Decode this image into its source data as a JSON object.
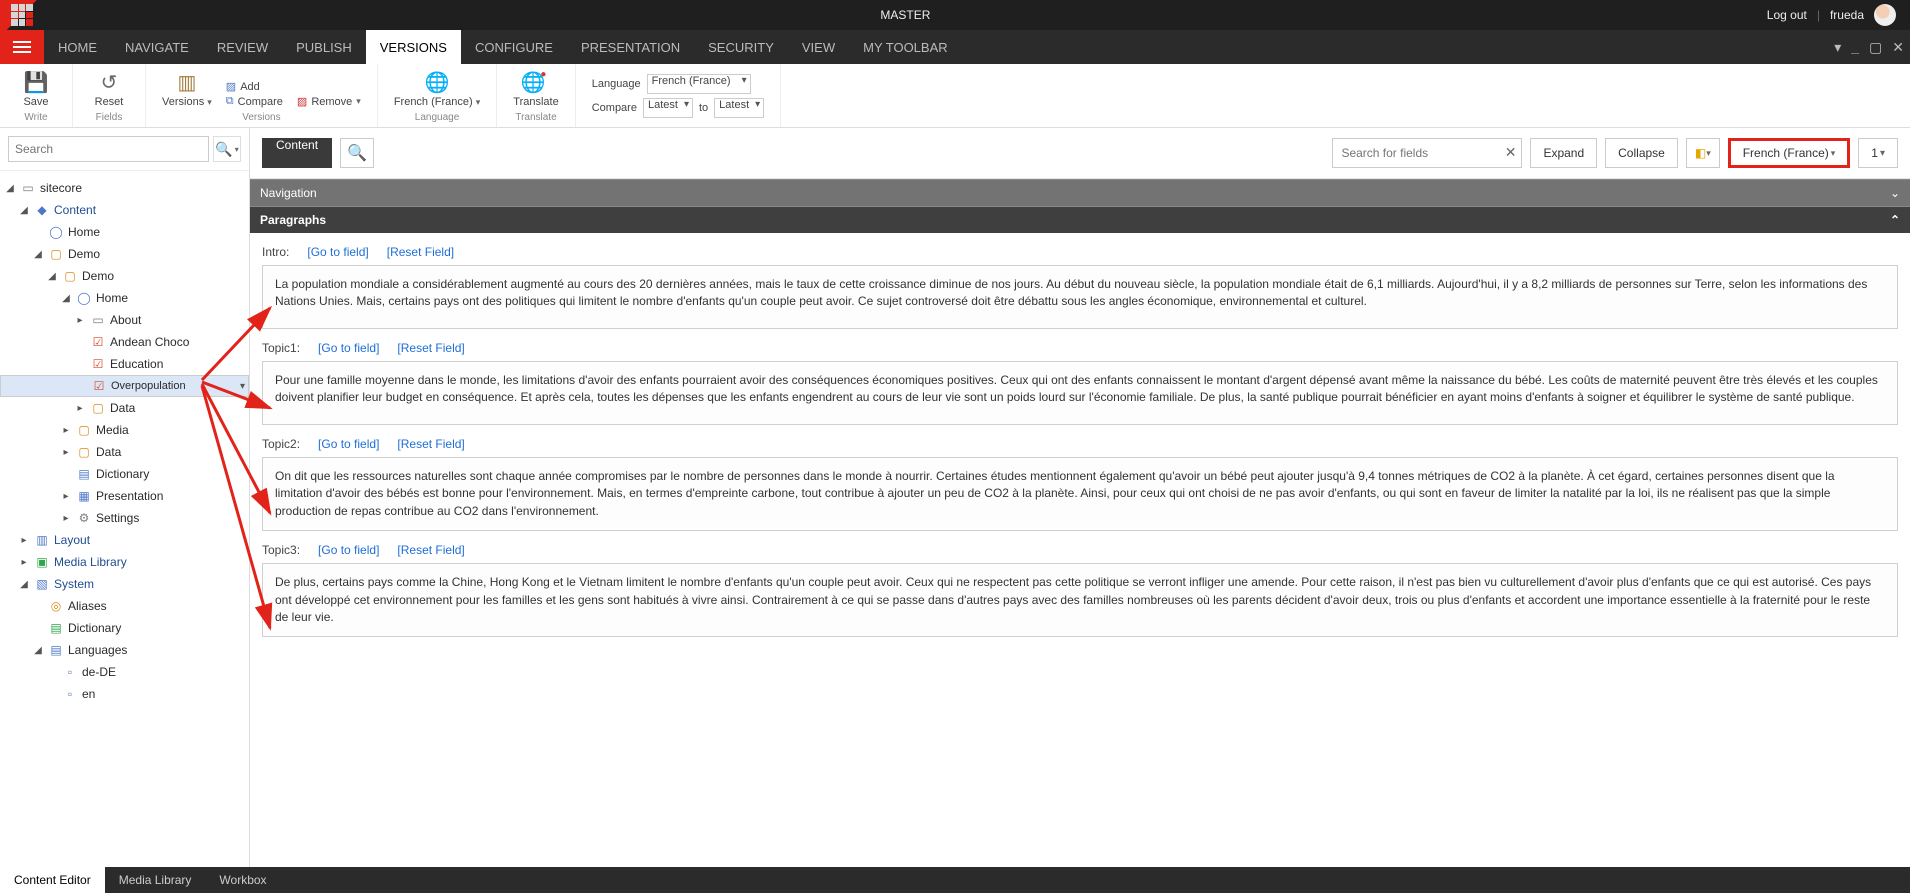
{
  "top": {
    "title": "MASTER",
    "logout": "Log out",
    "user": "frueda"
  },
  "menu": {
    "items": [
      "HOME",
      "NAVIGATE",
      "REVIEW",
      "PUBLISH",
      "VERSIONS",
      "CONFIGURE",
      "PRESENTATION",
      "SECURITY",
      "VIEW",
      "MY TOOLBAR"
    ],
    "active": "VERSIONS"
  },
  "ribbon": {
    "save": {
      "label": "Save",
      "sub": "Write"
    },
    "reset": {
      "label": "Reset",
      "sub": "Fields"
    },
    "versionsBtn": "Versions",
    "add": "Add",
    "compare": "Compare",
    "remove": "Remove",
    "versionsGroup": "Versions",
    "langBtn": "French (France)",
    "langGroup": "Language",
    "translate": "Translate",
    "translateGroup": "Translate",
    "langLabel": "Language",
    "langSel": "French (France)",
    "compareLabel": "Compare",
    "compareFrom": "Latest",
    "compareTo": "Latest",
    "to": "to"
  },
  "search": {
    "placeholder": "Search"
  },
  "tree": [
    {
      "d": 0,
      "open": true,
      "ic": "doc",
      "col": "gray",
      "lbl": "sitecore",
      "link": false
    },
    {
      "d": 1,
      "open": true,
      "ic": "cube",
      "col": "blue",
      "lbl": "Content",
      "link": true
    },
    {
      "d": 2,
      "open": false,
      "ic": "globe",
      "col": "blue",
      "lbl": "Home",
      "link": false,
      "leaf": true
    },
    {
      "d": 2,
      "open": true,
      "ic": "folder",
      "col": "orange",
      "lbl": "Demo",
      "link": false
    },
    {
      "d": 3,
      "open": true,
      "ic": "folder",
      "col": "orange",
      "lbl": "Demo",
      "link": false
    },
    {
      "d": 4,
      "open": true,
      "ic": "globe",
      "col": "blue",
      "lbl": "Home",
      "link": false
    },
    {
      "d": 5,
      "open": false,
      "ic": "doc",
      "col": "gray",
      "lbl": "About",
      "link": false
    },
    {
      "d": 5,
      "open": false,
      "ic": "chk",
      "col": "red",
      "lbl": "Andean Choco",
      "link": false,
      "leaf": true
    },
    {
      "d": 5,
      "open": false,
      "ic": "chk",
      "col": "red",
      "lbl": "Education",
      "link": false,
      "leaf": true
    },
    {
      "d": 5,
      "open": false,
      "ic": "chk",
      "col": "red",
      "lbl": "Overpopulation",
      "link": false,
      "leaf": true,
      "sel": true
    },
    {
      "d": 5,
      "open": false,
      "ic": "folder",
      "col": "orange",
      "lbl": "Data",
      "link": false
    },
    {
      "d": 4,
      "open": false,
      "ic": "folder",
      "col": "orange",
      "lbl": "Media",
      "link": false
    },
    {
      "d": 4,
      "open": false,
      "ic": "folder",
      "col": "orange",
      "lbl": "Data",
      "link": false
    },
    {
      "d": 4,
      "open": false,
      "ic": "book",
      "col": "blue",
      "lbl": "Dictionary",
      "link": false,
      "leaf": true
    },
    {
      "d": 4,
      "open": false,
      "ic": "slide",
      "col": "blue",
      "lbl": "Presentation",
      "link": false
    },
    {
      "d": 4,
      "open": false,
      "ic": "gear",
      "col": "gray",
      "lbl": "Settings",
      "link": false
    },
    {
      "d": 1,
      "open": false,
      "ic": "layout",
      "col": "blue",
      "lbl": "Layout",
      "link": true
    },
    {
      "d": 1,
      "open": false,
      "ic": "media",
      "col": "green",
      "lbl": "Media Library",
      "link": true
    },
    {
      "d": 1,
      "open": true,
      "ic": "sys",
      "col": "blue",
      "lbl": "System",
      "link": true
    },
    {
      "d": 2,
      "open": false,
      "ic": "alias",
      "col": "orange",
      "lbl": "Aliases",
      "link": false,
      "leaf": true
    },
    {
      "d": 2,
      "open": false,
      "ic": "book",
      "col": "green",
      "lbl": "Dictionary",
      "link": false,
      "leaf": true
    },
    {
      "d": 2,
      "open": true,
      "ic": "langs",
      "col": "blue",
      "lbl": "Languages",
      "link": false
    },
    {
      "d": 3,
      "open": false,
      "ic": "lang",
      "col": "blue",
      "lbl": "de-DE",
      "link": false,
      "leaf": true
    },
    {
      "d": 3,
      "open": false,
      "ic": "lang",
      "col": "blue",
      "lbl": "en",
      "link": false,
      "leaf": true
    }
  ],
  "toolbar": {
    "contentTab": "Content",
    "fieldSearch": "Search for fields",
    "expand": "Expand",
    "collapse": "Collapse",
    "language": "French (France)",
    "version": "1"
  },
  "sections": {
    "nav": "Navigation",
    "para": "Paragraphs",
    "goto": "[Go to field]",
    "reset": "[Reset Field]",
    "fields": [
      {
        "name": "Intro:",
        "text": "La population mondiale a considérablement augmenté au cours des 20 dernières années, mais le taux de cette croissance diminue de nos jours. Au début du nouveau siècle, la population mondiale était de 6,1 milliards. Aujourd'hui, il y a 8,2 milliards de personnes sur Terre, selon les informations des Nations Unies. Mais, certains pays ont des politiques qui limitent le nombre d'enfants qu'un couple peut avoir. Ce sujet controversé doit être débattu sous les angles économique, environnemental et culturel."
      },
      {
        "name": "Topic1:",
        "text": "Pour une famille moyenne dans le monde, les limitations d'avoir des enfants pourraient avoir des conséquences économiques positives. Ceux qui ont des enfants connaissent le montant d'argent dépensé avant même la naissance du bébé. Les coûts de maternité peuvent être très élevés et les couples doivent planifier leur budget en conséquence. Et après cela, toutes les dépenses que les enfants engendrent au cours de leur vie sont un poids lourd sur l'économie familiale. De plus, la santé publique pourrait bénéficier en ayant moins d'enfants à soigner et équilibrer le système de santé publique."
      },
      {
        "name": "Topic2:",
        "text": "On dit que les ressources naturelles sont chaque année compromises par le nombre de personnes dans le monde à nourrir. Certaines études mentionnent également qu'avoir un bébé peut ajouter jusqu'à 9,4 tonnes métriques de CO2 à la planète. À cet égard, certaines personnes disent que la limitation d'avoir des bébés est bonne pour l'environnement. Mais, en termes d'empreinte carbone, tout contribue à ajouter un peu de CO2 à la planète. Ainsi, pour ceux qui ont choisi de ne pas avoir d'enfants, ou qui sont en faveur de limiter la natalité par la loi, ils ne réalisent pas que la simple production de repas contribue au CO2 dans l'environnement."
      },
      {
        "name": "Topic3:",
        "text": "De plus, certains pays comme la Chine, Hong Kong et le Vietnam limitent le nombre d'enfants qu'un couple peut avoir. Ceux qui ne respectent pas cette politique se verront infliger une amende. Pour cette raison, il n'est pas bien vu culturellement d'avoir plus d'enfants que ce qui est autorisé. Ces pays ont développé cet environnement pour les familles et les gens sont habitués à vivre ainsi. Contrairement à ce qui se passe dans d'autres pays avec des familles nombreuses où les parents décident d'avoir deux, trois ou plus d'enfants et accordent une importance essentielle à la fraternité pour le reste de leur vie."
      }
    ]
  },
  "bottom": {
    "tabs": [
      "Content Editor",
      "Media Library",
      "Workbox"
    ],
    "active": "Content Editor"
  }
}
